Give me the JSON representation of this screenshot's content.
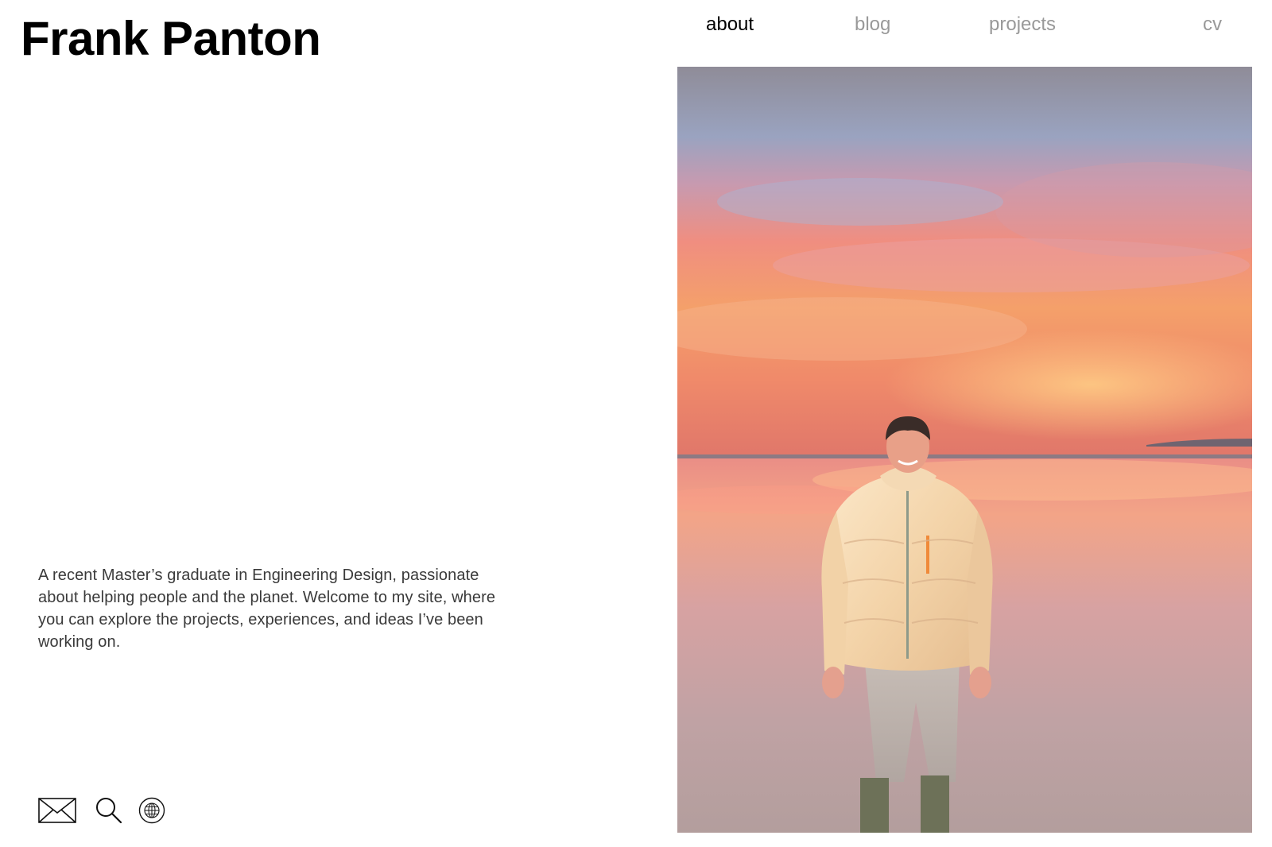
{
  "header": {
    "site_title": "Frank Panton"
  },
  "nav": {
    "items": [
      {
        "label": "about",
        "active": true
      },
      {
        "label": "blog",
        "active": false
      },
      {
        "label": "projects",
        "active": false
      },
      {
        "label": "cv",
        "active": false
      }
    ]
  },
  "intro": {
    "text": "A recent Master’s graduate in Engineering Design, passionate about helping people and the planet. Welcome to my site, where you can explore the projects, experiences, and ideas I’ve been working on."
  },
  "contact_icons": [
    "mail-icon",
    "search-icon",
    "globe-icon"
  ],
  "colors": {
    "text_primary": "#000000",
    "nav_inactive": "#999999",
    "body_text": "#3a3a3a",
    "background": "#ffffff"
  }
}
